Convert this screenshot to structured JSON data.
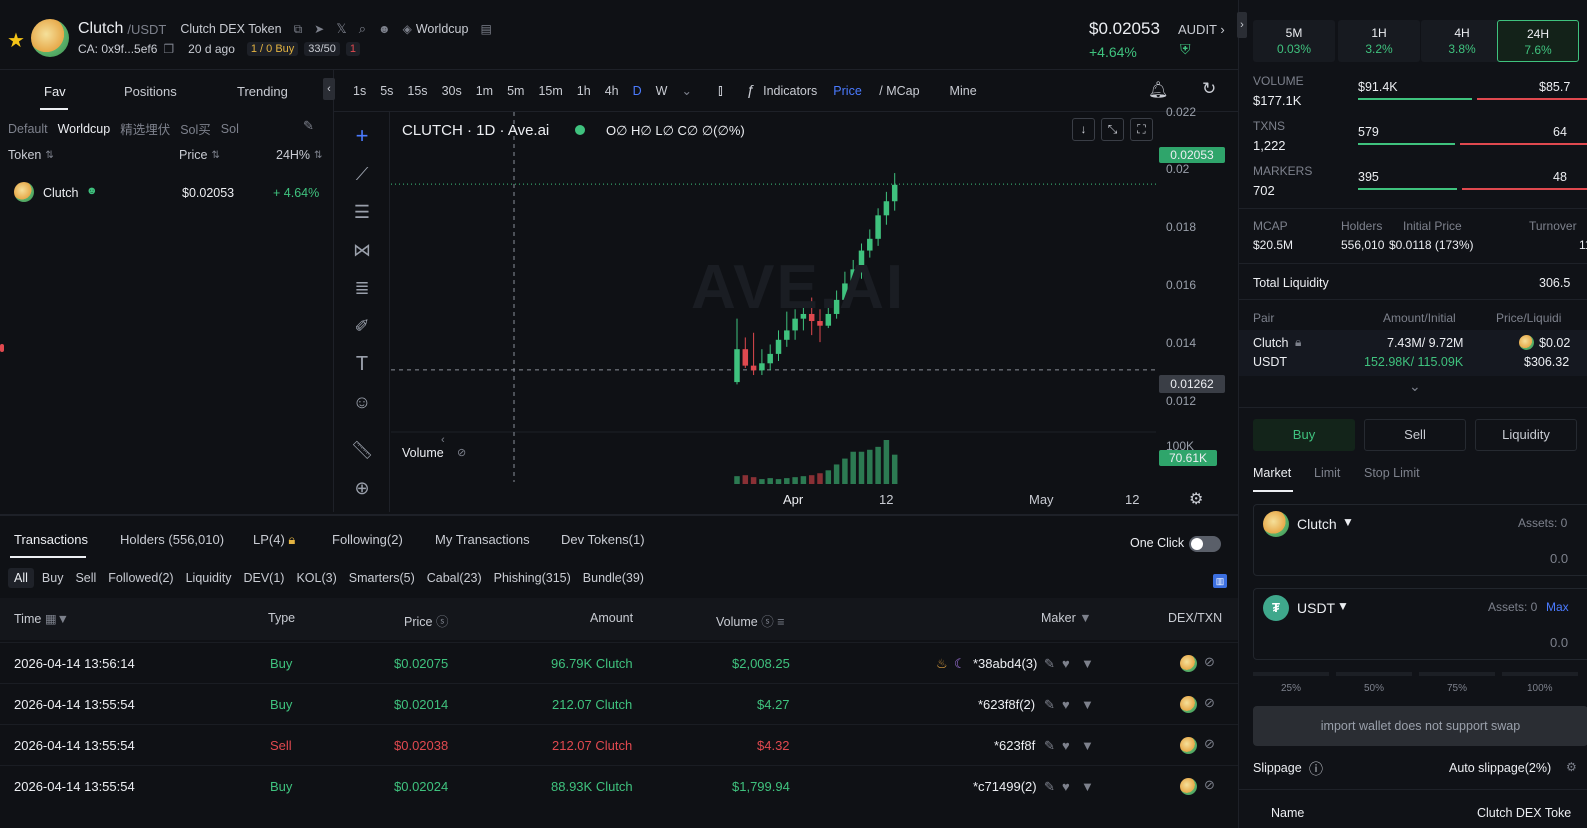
{
  "header": {
    "token_name": "Clutch",
    "pair_suffix": "/USDT",
    "full_name": "Clutch DEX Token",
    "ca": "CA: 0x9f...5ef6",
    "age": "20 d ago",
    "buy_count": "1 / 0 Buy",
    "holders_ratio": "33/50",
    "risk_count": "1",
    "community": "Worldcup",
    "price": "$0.02053",
    "change": "+4.64%",
    "audit": "AUDIT"
  },
  "left": {
    "tabs": [
      "Fav",
      "Positions",
      "Trending"
    ],
    "filters": [
      "Default",
      "Worldcup",
      "精选埋伏",
      "Sol买",
      "Sol"
    ],
    "col_token": "Token",
    "col_price": "Price",
    "col_change": "24H%",
    "rows": [
      {
        "name": "Clutch",
        "price": "$0.02053",
        "change": "+ 4.64%"
      }
    ]
  },
  "chart": {
    "timeframes": [
      "1s",
      "5s",
      "15s",
      "30s",
      "1m",
      "5m",
      "15m",
      "1h",
      "4h",
      "D",
      "W"
    ],
    "active_tf": "D",
    "indicators": "Indicators",
    "price_label": "Price",
    "mcap_label": "MCap",
    "mine": "Mine",
    "title": "CLUTCH · 1D · Ave.ai",
    "ohlc": "O∅ H∅ L∅ C∅ ∅(∅%)",
    "watermark": "AVE.AI",
    "volume_label": "Volume",
    "price_tag": "0.02053",
    "cross_tag": "0.01262",
    "volume_tag": "70.61K",
    "y_ticks": [
      "0.022",
      "0.02",
      "0.018",
      "0.016",
      "0.014",
      "0.012",
      "100K"
    ],
    "x_ticks": [
      "Apr",
      "12",
      "May",
      "12"
    ]
  },
  "chart_data": {
    "type": "candlestick",
    "y_ticks": [
      0.022,
      0.02,
      0.018,
      0.016,
      0.014,
      0.012
    ],
    "ylim": [
      0.0104,
      0.0236
    ],
    "last_price": 0.02053,
    "crosshair_price": 0.01262,
    "candles": [
      {
        "o": 0.0121,
        "h": 0.0148,
        "l": 0.012,
        "c": 0.0135
      },
      {
        "o": 0.0135,
        "h": 0.014,
        "l": 0.0127,
        "c": 0.0128
      },
      {
        "o": 0.0128,
        "h": 0.0142,
        "l": 0.0124,
        "c": 0.0126
      },
      {
        "o": 0.0126,
        "h": 0.0135,
        "l": 0.0124,
        "c": 0.0129
      },
      {
        "o": 0.0129,
        "h": 0.0137,
        "l": 0.0126,
        "c": 0.0133
      },
      {
        "o": 0.0133,
        "h": 0.0143,
        "l": 0.013,
        "c": 0.0139
      },
      {
        "o": 0.0139,
        "h": 0.0151,
        "l": 0.0136,
        "c": 0.0143
      },
      {
        "o": 0.0143,
        "h": 0.0152,
        "l": 0.0139,
        "c": 0.0148
      },
      {
        "o": 0.0148,
        "h": 0.0153,
        "l": 0.0143,
        "c": 0.015
      },
      {
        "o": 0.015,
        "h": 0.0157,
        "l": 0.0141,
        "c": 0.0147
      },
      {
        "o": 0.0147,
        "h": 0.0152,
        "l": 0.0138,
        "c": 0.0145
      },
      {
        "o": 0.0145,
        "h": 0.0154,
        "l": 0.0144,
        "c": 0.015
      },
      {
        "o": 0.015,
        "h": 0.016,
        "l": 0.0148,
        "c": 0.0156
      },
      {
        "o": 0.0156,
        "h": 0.0168,
        "l": 0.0154,
        "c": 0.0163
      },
      {
        "o": 0.0163,
        "h": 0.0173,
        "l": 0.0161,
        "c": 0.0169
      },
      {
        "o": 0.0169,
        "h": 0.018,
        "l": 0.0165,
        "c": 0.0177
      },
      {
        "o": 0.0177,
        "h": 0.0186,
        "l": 0.0174,
        "c": 0.0182
      },
      {
        "o": 0.0182,
        "h": 0.0195,
        "l": 0.0179,
        "c": 0.0192
      },
      {
        "o": 0.0192,
        "h": 0.0202,
        "l": 0.0188,
        "c": 0.0198
      },
      {
        "o": 0.0198,
        "h": 0.021,
        "l": 0.0194,
        "c": 0.0205
      }
    ],
    "volumes": [
      8,
      9,
      7,
      5,
      6,
      5,
      6,
      7,
      8,
      9,
      11,
      14,
      20,
      26,
      33,
      33,
      35,
      38,
      45,
      30
    ]
  },
  "bottom": {
    "tabs": [
      "Transactions",
      "Holders (556,010)",
      "LP(4)",
      "Following(2)",
      "My Transactions",
      "Dev Tokens(1)"
    ],
    "one_click": "One Click",
    "filters": [
      "All",
      "Buy",
      "Sell",
      "Followed(2)",
      "Liquidity",
      "DEV(1)",
      "KOL(3)",
      "Smarters(5)",
      "Cabal(23)",
      "Phishing(315)",
      "Bundle(39)"
    ],
    "cols": {
      "time": "Time",
      "type": "Type",
      "price": "Price",
      "amount": "Amount",
      "volume": "Volume",
      "maker": "Maker",
      "dex": "DEX/TXN"
    },
    "rows": [
      {
        "time": "2026-04-14 13:56:14",
        "type": "Buy",
        "price": "$0.02075",
        "amount": "96.79K Clutch",
        "volume": "$2,008.25",
        "maker": "*38abd4(3)"
      },
      {
        "time": "2026-04-14 13:55:54",
        "type": "Buy",
        "price": "$0.02014",
        "amount": "212.07 Clutch",
        "volume": "$4.27",
        "maker": "*623f8f(2)"
      },
      {
        "time": "2026-04-14 13:55:54",
        "type": "Sell",
        "price": "$0.02038",
        "amount": "212.07 Clutch",
        "volume": "$4.32",
        "maker": "*623f8f"
      },
      {
        "time": "2026-04-14 13:55:54",
        "type": "Buy",
        "price": "$0.02024",
        "amount": "88.93K Clutch",
        "volume": "$1,799.94",
        "maker": "*c71499(2)"
      }
    ]
  },
  "right": {
    "tf": [
      {
        "label": "5M",
        "value": "0.03%"
      },
      {
        "label": "1H",
        "value": "3.2%"
      },
      {
        "label": "4H",
        "value": "3.8%"
      },
      {
        "label": "24H",
        "value": "7.6%"
      }
    ],
    "stats": [
      {
        "label": "VOLUME",
        "value": "$177.1K",
        "buy": "$91.4K",
        "sell": "$85.7"
      },
      {
        "label": "TXNS",
        "value": "1,222",
        "buy": "579",
        "sell": "64"
      },
      {
        "label": "MARKERS",
        "value": "702",
        "buy": "395",
        "sell": "48"
      }
    ],
    "metrics": [
      {
        "label": "MCAP",
        "value": "$20.5M"
      },
      {
        "label": "Holders",
        "value": "556,010"
      },
      {
        "label": "Initial Price",
        "value": "$0.0118 (173%)"
      },
      {
        "label": "Turnover",
        "value": "11"
      }
    ],
    "total_liquidity_label": "Total Liquidity",
    "total_liquidity": "306.5",
    "pair_cols": {
      "pair": "Pair",
      "amount": "Amount/Initial",
      "price": "Price/Liquidi"
    },
    "pairs": [
      {
        "name": "Clutch",
        "amount": "7.43M/ 9.72M",
        "price": "$0.02"
      },
      {
        "name": "USDT",
        "amount": "152.98K/ 115.09K",
        "price": "$306.32"
      }
    ],
    "actions": [
      "Buy",
      "Sell",
      "Liquidity"
    ],
    "order_tabs": [
      "Market",
      "Limit",
      "Stop Limit"
    ],
    "from_token": "Clutch",
    "to_token": "USDT",
    "assets": "Assets: 0",
    "assets2": "Assets: 0",
    "max": "Max",
    "zero": "0.0",
    "zero2": "0.0",
    "pcts": [
      "25%",
      "50%",
      "75%",
      "100%"
    ],
    "swap_note": "import wallet does not support swap",
    "slippage": "Slippage",
    "auto_slippage": "Auto slippage(2%)",
    "name_label": "Name",
    "name_value": "Clutch DEX Toke"
  },
  "colors": {
    "up": "#3fc27e",
    "down": "#e0494f",
    "accent": "#4b7bff",
    "bg": "#0f1115"
  }
}
